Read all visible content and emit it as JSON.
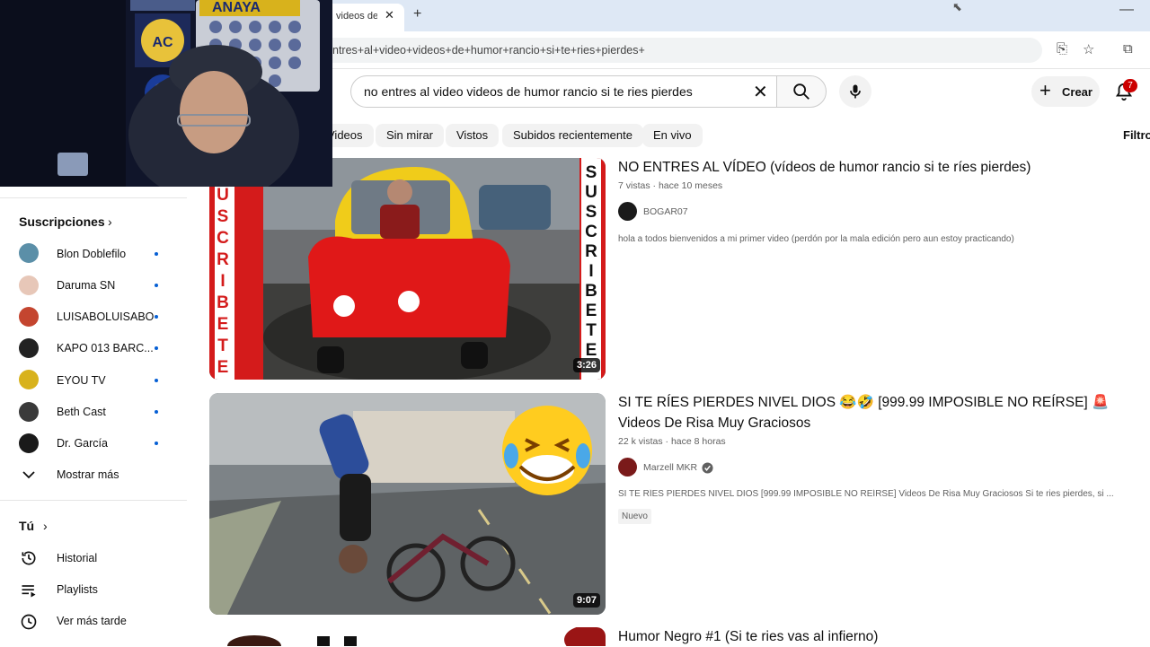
{
  "browser": {
    "tab_title": "videos de",
    "url": "ntres+al+video+videos+de+humor+rancio+si+te+ries+pierdes+"
  },
  "search": {
    "value": "no entres al video videos de humor rancio si te ries pierdes"
  },
  "header": {
    "create_label": "Crear",
    "notification_count": "7"
  },
  "chips": [
    "Videos",
    "Sin mirar",
    "Vistos",
    "Subidos recientemente",
    "En vivo"
  ],
  "filters_label": "Filtro",
  "sidebar": {
    "subscriptions_title": "Suscripciones",
    "subscriptions": [
      {
        "name": "Blon Doblefilo",
        "color": "#5b8fa8"
      },
      {
        "name": "Daruma SN",
        "color": "#e7c7b8"
      },
      {
        "name": "LUISABOLUISABO",
        "color": "#c4452f"
      },
      {
        "name": "KAPO 013 BARC...",
        "color": "#222222"
      },
      {
        "name": "EYOU TV",
        "color": "#d8b21c"
      },
      {
        "name": "Beth Cast",
        "color": "#3a3a3a"
      },
      {
        "name": "Dr. García",
        "color": "#1a1a1a"
      }
    ],
    "show_more": "Mostrar más",
    "you_title": "Tú",
    "you_items": [
      {
        "label": "Historial",
        "icon": "history-icon"
      },
      {
        "label": "Playlists",
        "icon": "playlists-icon"
      },
      {
        "label": "Ver más tarde",
        "icon": "watch-later-icon"
      }
    ]
  },
  "results": [
    {
      "title": "NO ENTRES AL VÍDEO (vídeos de humor rancio si te ríes pierdes)",
      "views": "7 vistas",
      "age": "hace 10 meses",
      "channel": "BOGAR07",
      "verified": false,
      "description": "hola a todos bienvenidos a mi primer video (perdón por la mala edición pero aun estoy practicando)",
      "duration": "3:26",
      "thumb_text": [
        "S",
        "U",
        "S",
        "C",
        "R",
        "I",
        "B",
        "E",
        "T",
        "E"
      ]
    },
    {
      "title": "SI TE RÍES PIERDES NIVEL DIOS 😂🤣 [999.99 IMPOSIBLE NO REÍRSE] 🚨 Videos De Risa Muy Graciosos",
      "views": "22 k vistas",
      "age": "hace 8 horas",
      "channel": "Marzell MKR",
      "verified": true,
      "description": "SI TE RÍES PIERDES NIVEL DIOS [999.99 IMPOSIBLE NO REÍRSE] Videos De Risa Muy Graciosos Si te ries pierdes, si ...",
      "badge": "Nuevo",
      "duration": "9:07"
    },
    {
      "title": "Humor Negro #1 (Si te ries vas al infierno)"
    }
  ],
  "webcam": {
    "banner_text": "ANAYA"
  }
}
